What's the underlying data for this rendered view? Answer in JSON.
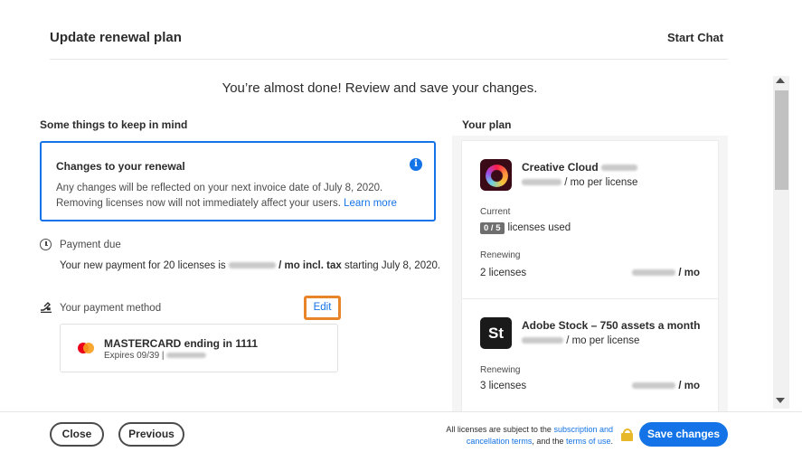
{
  "header": {
    "title": "Update renewal plan",
    "start_chat": "Start Chat"
  },
  "headline": "You’re almost done! Review and save your changes.",
  "left": {
    "section_title": "Some things to keep in mind",
    "notice": {
      "title": "Changes to your renewal",
      "body": "Any changes will be reflected on your next invoice date of July 8, 2020. Removing licenses now will not immediately affect your users.",
      "link": "Learn more"
    },
    "payment_due": {
      "label": "Payment due",
      "text_prefix": "Your new payment for 20 licenses is",
      "text_mid": "/ mo incl. tax",
      "text_suffix": "starting July 8, 2020."
    },
    "payment_method": {
      "label": "Your payment method",
      "edit": "Edit",
      "card_title": "MASTERCARD ending in 1111",
      "card_expires": "Expires 09/39 |"
    }
  },
  "right": {
    "section_title": "Your plan",
    "products": [
      {
        "name": "Creative Cloud",
        "price_suffix": "/ mo per license",
        "current_label": "Current",
        "usage_badge": "0 / 5",
        "usage_text": "licenses used",
        "renewing_label": "Renewing",
        "renewing_value": "2 licenses",
        "renewing_price_suffix": "/ mo"
      },
      {
        "name": "Adobe Stock – 750 assets a month",
        "icon_text": "St",
        "price_suffix": "/ mo per license",
        "renewing_label": "Renewing",
        "renewing_value": "3 licenses",
        "renewing_price_suffix": "/ mo"
      }
    ]
  },
  "footer": {
    "close": "Close",
    "previous": "Previous",
    "legal_prefix": "All licenses are subject to the",
    "legal_link1": "subscription and cancellation terms",
    "legal_mid": ", and the",
    "legal_link2": "terms of use",
    "legal_end": ".",
    "save": "Save changes"
  },
  "colors": {
    "accent": "#1473e6",
    "highlight": "#e8842a"
  }
}
